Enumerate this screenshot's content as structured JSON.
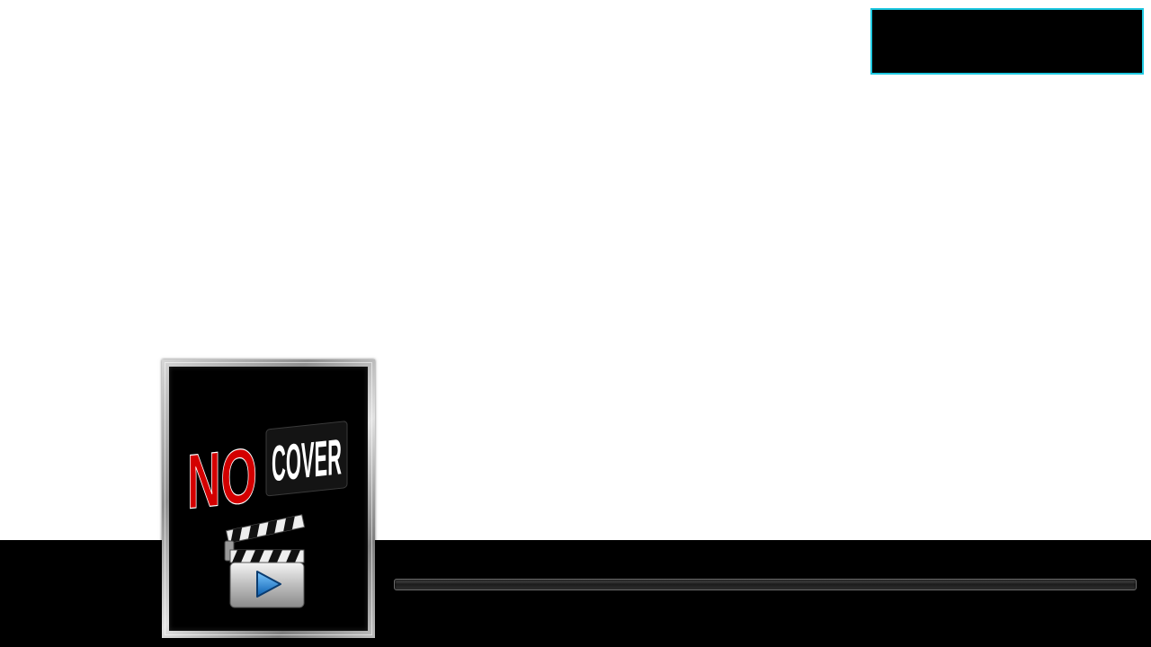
{
  "poster": {
    "logo_text_left": "NO",
    "logo_text_right": "COVER",
    "icon": "clapperboard-play-icon"
  },
  "player": {
    "progress": 0
  },
  "colors": {
    "background": "#ffffff",
    "bar": "#000000",
    "info_box_border": "#1ec8e0",
    "logo_red": "#d40000",
    "play_blue": "#1e8fe0"
  }
}
